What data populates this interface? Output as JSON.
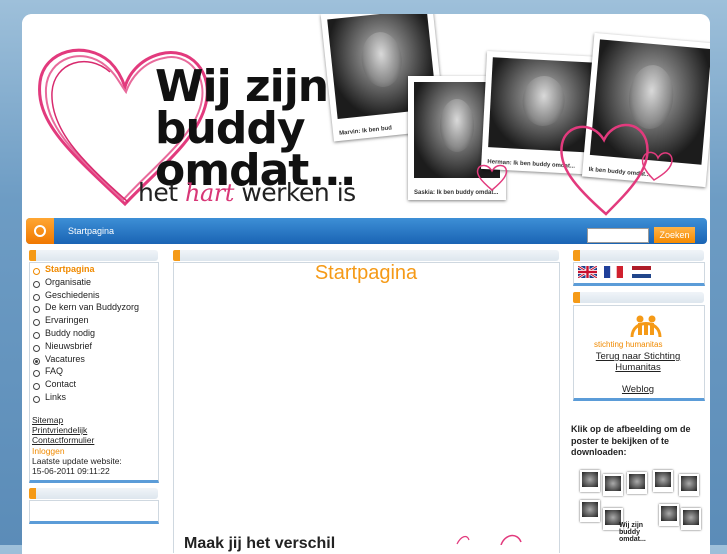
{
  "header": {
    "title_lines": [
      "Wij zijn",
      "buddy",
      "omdat..."
    ],
    "subtitle_before": "het",
    "subtitle_highlight": "hart",
    "subtitle_after": "werken is",
    "photo_captions": [
      "Marvin: Ik ben bud",
      "Saskia: Ik ben buddy omdat...",
      "Herman: Ik ben buddy omdat...",
      "Ik ben buddy omdat..."
    ]
  },
  "nav": {
    "breadcrumb": "Startpagina",
    "search_placeholder": "",
    "search_button": "Zoeken"
  },
  "sidebar": {
    "menu": [
      {
        "label": "Startpagina",
        "state": "active"
      },
      {
        "label": "Organisatie",
        "state": "normal"
      },
      {
        "label": "Geschiedenis",
        "state": "normal"
      },
      {
        "label": "De kern van Buddyzorg",
        "state": "normal"
      },
      {
        "label": "Ervaringen",
        "state": "normal"
      },
      {
        "label": "Buddy nodig",
        "state": "normal"
      },
      {
        "label": "Nieuwsbrief",
        "state": "normal"
      },
      {
        "label": "Vacatures",
        "state": "selected"
      },
      {
        "label": "FAQ",
        "state": "normal"
      },
      {
        "label": "Contact",
        "state": "normal"
      },
      {
        "label": "Links",
        "state": "normal"
      }
    ],
    "sitemap": "Sitemap",
    "printfriendly": "Printvriendelijk",
    "contactform": "Contactformulier",
    "login": "Inloggen",
    "last_update_label": "Laatste update website:",
    "last_update_value": "15-06-2011 09:11:22"
  },
  "main": {
    "title": "Startpagina",
    "teaser": "Maak jij het verschil"
  },
  "right": {
    "flags": [
      "english-flag",
      "french-flag",
      "dutch-flag"
    ],
    "humanitas_name": "stichting humanitas",
    "humanitas_link": "Terug naar Stichting Humanitas",
    "weblog": "Weblog",
    "poster_text": "Klik op de afbeelding om de poster te bekijken of te downloaden:",
    "poster_title": "Wij zijn buddy omdat..."
  },
  "colors": {
    "accent": "#f59a17",
    "nav_blue": "#1a64b4",
    "heart_pink": "#e23a7d",
    "background": "#6d9cc4"
  }
}
